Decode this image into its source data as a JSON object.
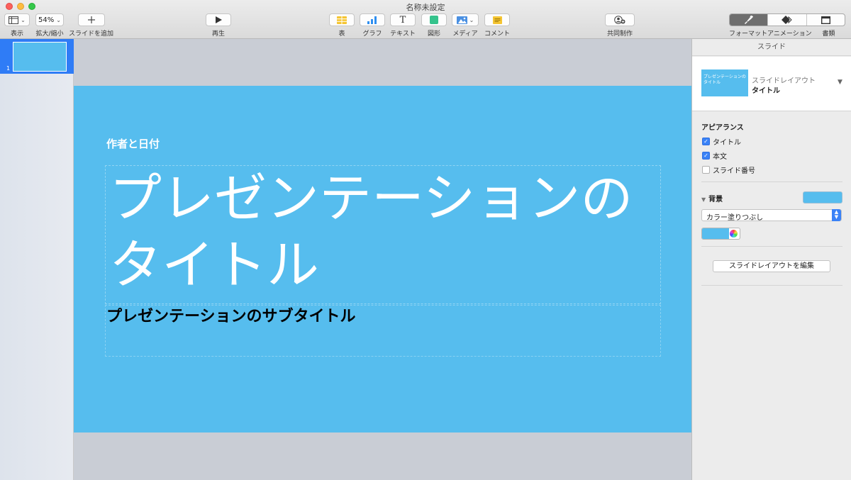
{
  "window": {
    "title": "名称未設定"
  },
  "toolbar": {
    "view_label": "表示",
    "zoom_value": "54%",
    "zoom_label": "拡大/縮小",
    "add_slide_label": "スライドを追加",
    "play_label": "再生",
    "table_label": "表",
    "chart_label": "グラフ",
    "text_label": "テキスト",
    "shape_label": "図形",
    "media_label": "メディア",
    "comment_label": "コメント",
    "collaborate_label": "共同制作",
    "format_label": "フォーマット",
    "animate_label": "アニメーション",
    "document_label": "書類",
    "icon_text_glyph": "T"
  },
  "navigator": {
    "slides": [
      {
        "number": "1"
      }
    ]
  },
  "slide": {
    "author_date": "作者と日付",
    "title": "プレゼンテーションのタイトル",
    "subtitle": "プレゼンテーションのサブタイトル",
    "background_color": "#56bdee"
  },
  "inspector": {
    "header": "スライド",
    "layout_caption": "スライドレイアウト",
    "layout_name": "タイトル",
    "layout_thumb_text": "プレゼンテーションのタイトル",
    "appearance_title": "アピアランス",
    "checkboxes": [
      {
        "label": "タイトル",
        "checked": true
      },
      {
        "label": "本文",
        "checked": true
      },
      {
        "label": "スライド番号",
        "checked": false
      }
    ],
    "background_title": "背景",
    "fill_type": "カラー塗りつぶし",
    "edit_layout_label": "スライドレイアウトを編集"
  },
  "colors": {
    "accent": "#3a82f7",
    "slide_bg": "#56bdee",
    "selection": "#2f7cf6"
  }
}
